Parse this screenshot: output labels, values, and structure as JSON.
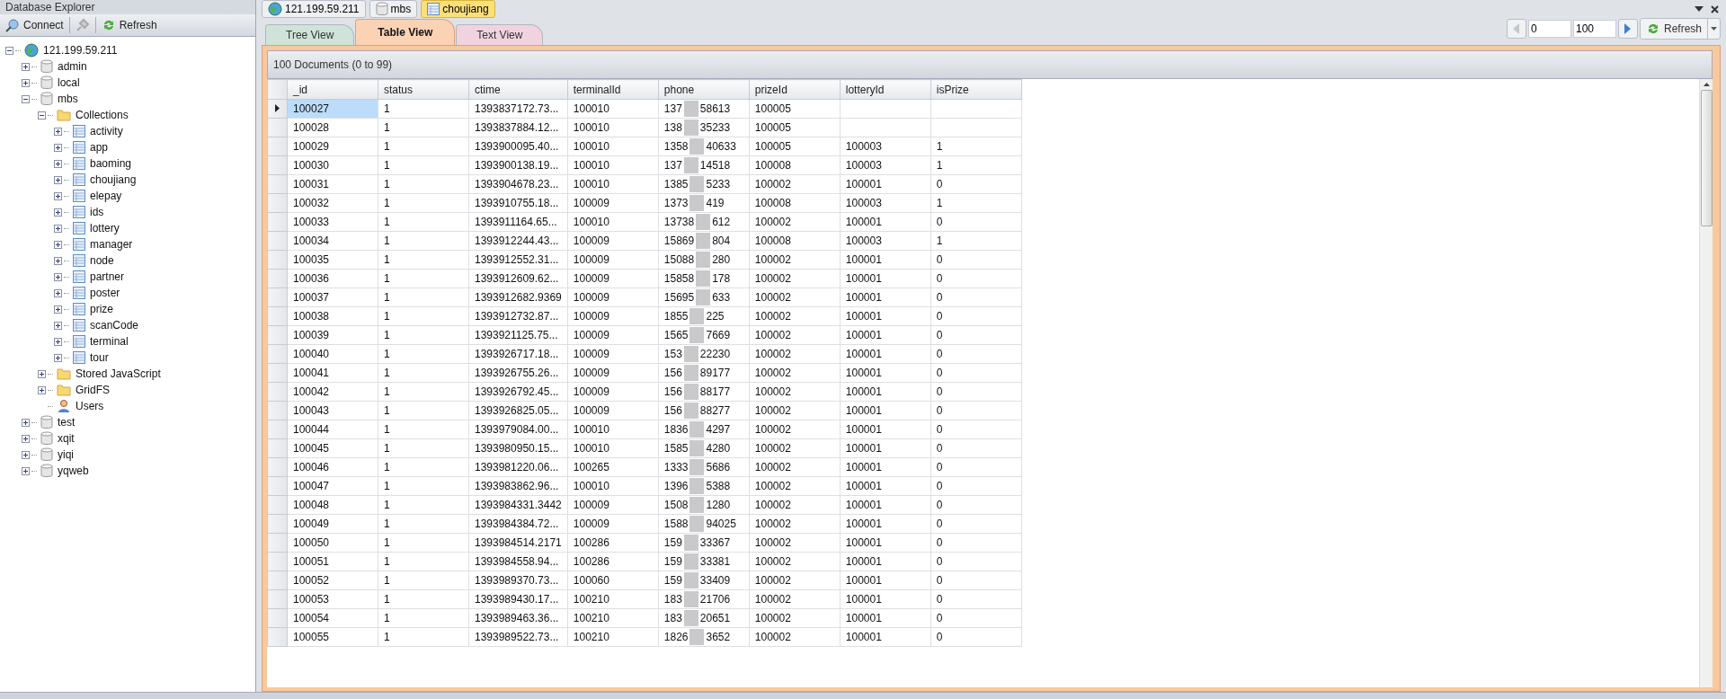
{
  "explorer": {
    "title": "Database Explorer",
    "toolbar": [
      {
        "kind": "connect",
        "label": "Connect",
        "disabled": false
      },
      {
        "kind": "disconnect",
        "disabled": true
      },
      {
        "kind": "refresh",
        "label": "Refresh",
        "disabled": false
      }
    ],
    "tree": [
      {
        "label": "121.199.59.211",
        "kind": "server",
        "expanded": true,
        "children": [
          {
            "label": "admin",
            "kind": "database",
            "expanded": false
          },
          {
            "label": "local",
            "kind": "database",
            "expanded": false
          },
          {
            "label": "mbs",
            "kind": "database",
            "expanded": true,
            "children": [
              {
                "label": "Collections",
                "kind": "folder",
                "expanded": true,
                "children": [
                  {
                    "label": "activity",
                    "kind": "collection",
                    "expanded": false
                  },
                  {
                    "label": "app",
                    "kind": "collection",
                    "expanded": false
                  },
                  {
                    "label": "baoming",
                    "kind": "collection",
                    "expanded": false
                  },
                  {
                    "label": "choujiang",
                    "kind": "collection",
                    "expanded": false
                  },
                  {
                    "label": "elepay",
                    "kind": "collection",
                    "expanded": false
                  },
                  {
                    "label": "ids",
                    "kind": "collection",
                    "expanded": false
                  },
                  {
                    "label": "lottery",
                    "kind": "collection",
                    "expanded": false
                  },
                  {
                    "label": "manager",
                    "kind": "collection",
                    "expanded": false
                  },
                  {
                    "label": "node",
                    "kind": "collection",
                    "expanded": false
                  },
                  {
                    "label": "partner",
                    "kind": "collection",
                    "expanded": false
                  },
                  {
                    "label": "poster",
                    "kind": "collection",
                    "expanded": false
                  },
                  {
                    "label": "prize",
                    "kind": "collection",
                    "expanded": false
                  },
                  {
                    "label": "scanCode",
                    "kind": "collection",
                    "expanded": false
                  },
                  {
                    "label": "terminal",
                    "kind": "collection",
                    "expanded": false
                  },
                  {
                    "label": "tour",
                    "kind": "collection",
                    "expanded": false
                  }
                ]
              },
              {
                "label": "Stored JavaScript",
                "kind": "folder",
                "expanded": false
              },
              {
                "label": "GridFS",
                "kind": "folder",
                "expanded": false
              },
              {
                "label": "Users",
                "kind": "users"
              }
            ]
          },
          {
            "label": "test",
            "kind": "database",
            "expanded": false
          },
          {
            "label": "xqit",
            "kind": "database",
            "expanded": false
          },
          {
            "label": "yiqi",
            "kind": "database",
            "expanded": false
          },
          {
            "label": "yqweb",
            "kind": "database",
            "expanded": false
          }
        ]
      }
    ]
  },
  "breadcrumb": [
    {
      "label": "121.199.59.211",
      "kind": "server",
      "selected": false
    },
    {
      "label": "mbs",
      "kind": "database",
      "selected": false
    },
    {
      "label": "choujiang",
      "kind": "collection",
      "selected": true
    }
  ],
  "tabs": [
    {
      "label": "Tree View",
      "selected": false,
      "color": "#cfe3d8"
    },
    {
      "label": "Table View",
      "selected": true,
      "color": "#fbd3b4"
    },
    {
      "label": "Text View",
      "selected": false,
      "color": "#f1d3e0"
    }
  ],
  "pager": {
    "prev_disabled": true,
    "skip": "0",
    "limit": "100",
    "next_disabled": false,
    "refresh": "Refresh"
  },
  "documents": {
    "summary": "100 Documents (0 to 99)",
    "columns": [
      "_id",
      "status",
      "ctime",
      "terminalId",
      "phone",
      "prizeId",
      "lotteryId",
      "isPrize"
    ],
    "rows": [
      {
        "selected": true,
        "cells": [
          "100027",
          "1",
          "1393837172.73...",
          "100010",
          {
            "start": "137",
            "end": "58613"
          },
          "100005",
          null,
          null
        ]
      },
      {
        "selected": false,
        "cells": [
          "100028",
          "1",
          "1393837884.12...",
          "100010",
          {
            "start": "138",
            "end": "35233"
          },
          "100005",
          null,
          null
        ]
      },
      {
        "selected": false,
        "cells": [
          "100029",
          "1",
          "1393900095.40...",
          "100010",
          {
            "start": "1358",
            "end": "40633"
          },
          "100005",
          "100003",
          "1"
        ]
      },
      {
        "selected": false,
        "cells": [
          "100030",
          "1",
          "1393900138.19...",
          "100010",
          {
            "start": "137",
            "end": "14518"
          },
          "100008",
          "100003",
          "1"
        ]
      },
      {
        "selected": false,
        "cells": [
          "100031",
          "1",
          "1393904678.23...",
          "100010",
          {
            "start": "1385",
            "end": "5233"
          },
          "100002",
          "100001",
          "0"
        ]
      },
      {
        "selected": false,
        "cells": [
          "100032",
          "1",
          "1393910755.18...",
          "100009",
          {
            "start": "1373",
            "end": "419"
          },
          "100008",
          "100003",
          "1"
        ]
      },
      {
        "selected": false,
        "cells": [
          "100033",
          "1",
          "1393911164.65...",
          "100010",
          {
            "start": "13738",
            "end": "612"
          },
          "100002",
          "100001",
          "0"
        ]
      },
      {
        "selected": false,
        "cells": [
          "100034",
          "1",
          "1393912244.43...",
          "100009",
          {
            "start": "15869",
            "end": "804"
          },
          "100008",
          "100003",
          "1"
        ]
      },
      {
        "selected": false,
        "cells": [
          "100035",
          "1",
          "1393912552.31...",
          "100009",
          {
            "start": "15088",
            "end": "280"
          },
          "100002",
          "100001",
          "0"
        ]
      },
      {
        "selected": false,
        "cells": [
          "100036",
          "1",
          "1393912609.62...",
          "100009",
          {
            "start": "15858",
            "end": "178"
          },
          "100002",
          "100001",
          "0"
        ]
      },
      {
        "selected": false,
        "cells": [
          "100037",
          "1",
          "1393912682.9369",
          "100009",
          {
            "start": "15695",
            "end": "633"
          },
          "100002",
          "100001",
          "0"
        ]
      },
      {
        "selected": false,
        "cells": [
          "100038",
          "1",
          "1393912732.87...",
          "100009",
          {
            "start": "1855",
            "end": "225"
          },
          "100002",
          "100001",
          "0"
        ]
      },
      {
        "selected": false,
        "cells": [
          "100039",
          "1",
          "1393921125.75...",
          "100009",
          {
            "start": "1565",
            "end": "7669"
          },
          "100002",
          "100001",
          "0"
        ]
      },
      {
        "selected": false,
        "cells": [
          "100040",
          "1",
          "1393926717.18...",
          "100009",
          {
            "start": "153",
            "end": "22230"
          },
          "100002",
          "100001",
          "0"
        ]
      },
      {
        "selected": false,
        "cells": [
          "100041",
          "1",
          "1393926755.26...",
          "100009",
          {
            "start": "156",
            "end": "89177"
          },
          "100002",
          "100001",
          "0"
        ]
      },
      {
        "selected": false,
        "cells": [
          "100042",
          "1",
          "1393926792.45...",
          "100009",
          {
            "start": "156",
            "end": "88177"
          },
          "100002",
          "100001",
          "0"
        ]
      },
      {
        "selected": false,
        "cells": [
          "100043",
          "1",
          "1393926825.05...",
          "100009",
          {
            "start": "156",
            "end": "88277"
          },
          "100002",
          "100001",
          "0"
        ]
      },
      {
        "selected": false,
        "cells": [
          "100044",
          "1",
          "1393979084.00...",
          "100010",
          {
            "start": "1836",
            "end": "4297"
          },
          "100002",
          "100001",
          "0"
        ]
      },
      {
        "selected": false,
        "cells": [
          "100045",
          "1",
          "1393980950.15...",
          "100010",
          {
            "start": "1585",
            "end": "4280"
          },
          "100002",
          "100001",
          "0"
        ]
      },
      {
        "selected": false,
        "cells": [
          "100046",
          "1",
          "1393981220.06...",
          "100265",
          {
            "start": "1333",
            "end": "5686"
          },
          "100002",
          "100001",
          "0"
        ]
      },
      {
        "selected": false,
        "cells": [
          "100047",
          "1",
          "1393983862.96...",
          "100010",
          {
            "start": "1396",
            "end": "5388"
          },
          "100002",
          "100001",
          "0"
        ]
      },
      {
        "selected": false,
        "cells": [
          "100048",
          "1",
          "1393984331.3442",
          "100009",
          {
            "start": "1508",
            "end": "1280"
          },
          "100002",
          "100001",
          "0"
        ]
      },
      {
        "selected": false,
        "cells": [
          "100049",
          "1",
          "1393984384.72...",
          "100009",
          {
            "start": "1588",
            "end": "94025"
          },
          "100002",
          "100001",
          "0"
        ]
      },
      {
        "selected": false,
        "cells": [
          "100050",
          "1",
          "1393984514.2171",
          "100286",
          {
            "start": "159",
            "end": "33367"
          },
          "100002",
          "100001",
          "0"
        ]
      },
      {
        "selected": false,
        "cells": [
          "100051",
          "1",
          "1393984558.94...",
          "100286",
          {
            "start": "159",
            "end": "33381"
          },
          "100002",
          "100001",
          "0"
        ]
      },
      {
        "selected": false,
        "cells": [
          "100052",
          "1",
          "1393989370.73...",
          "100060",
          {
            "start": "159",
            "end": "33409"
          },
          "100002",
          "100001",
          "0"
        ]
      },
      {
        "selected": false,
        "cells": [
          "100053",
          "1",
          "1393989430.17...",
          "100210",
          {
            "start": "183",
            "end": "21706"
          },
          "100002",
          "100001",
          "0"
        ]
      },
      {
        "selected": false,
        "cells": [
          "100054",
          "1",
          "1393989463.36...",
          "100210",
          {
            "start": "183",
            "end": "20651"
          },
          "100002",
          "100001",
          "0"
        ]
      },
      {
        "selected": false,
        "cells": [
          "100055",
          "1",
          "1393989522.73...",
          "100210",
          {
            "start": "1826",
            "end": "3652"
          },
          "100002",
          "100001",
          "0"
        ]
      }
    ]
  }
}
